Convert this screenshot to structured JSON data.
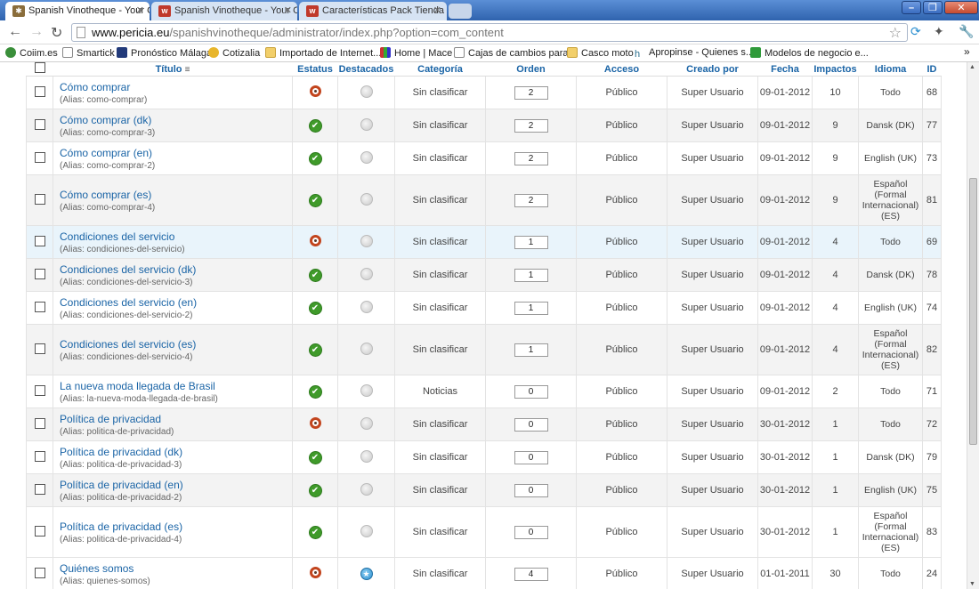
{
  "browser": {
    "tabs": [
      {
        "title": "Spanish Vinotheque - Your Or",
        "active": true
      },
      {
        "title": "Spanish Vinotheque - Your Or",
        "active": false
      },
      {
        "title": "Características Pack Tienda -",
        "active": false
      }
    ],
    "url_host": "www.pericia.eu",
    "url_path": "/spanishvinotheque/administrator/index.php?option=com_content",
    "bookmarks": [
      "Coiim.es",
      "Smartick",
      "Pronóstico Málaga",
      "Cotizalia",
      "Importado de Internet...",
      "Home | Mace",
      "Cajas de cambios para...",
      "Casco moto",
      "Apropinse - Quienes s...",
      "Modelos de negocio e..."
    ],
    "more_chevron": "»"
  },
  "table": {
    "headers": {
      "title": "Título",
      "status": "Estatus",
      "featured": "Destacados",
      "category": "Categoría",
      "order": "Orden",
      "access": "Acceso",
      "created_by": "Creado por",
      "date": "Fecha",
      "hits": "Impactos",
      "language": "Idioma",
      "id": "ID"
    },
    "rows": [
      {
        "title": "Cómo comprar",
        "alias": "(Alias: como-comprar)",
        "status": "unpublished",
        "featured": false,
        "category": "Sin clasificar",
        "order": "2",
        "access": "Público",
        "author": "Super Usuario",
        "date": "09-01-2012",
        "hits": "10",
        "language": "Todo",
        "id": "68"
      },
      {
        "title": "Cómo comprar (dk)",
        "alias": "(Alias: como-comprar-3)",
        "status": "published",
        "featured": false,
        "category": "Sin clasificar",
        "order": "2",
        "access": "Público",
        "author": "Super Usuario",
        "date": "09-01-2012",
        "hits": "9",
        "language": "Dansk (DK)",
        "id": "77"
      },
      {
        "title": "Cómo comprar (en)",
        "alias": "(Alias: como-comprar-2)",
        "status": "published",
        "featured": false,
        "category": "Sin clasificar",
        "order": "2",
        "access": "Público",
        "author": "Super Usuario",
        "date": "09-01-2012",
        "hits": "9",
        "language": "English (UK)",
        "id": "73"
      },
      {
        "title": "Cómo comprar (es)",
        "alias": "(Alias: como-comprar-4)",
        "status": "published",
        "featured": false,
        "category": "Sin clasificar",
        "order": "2",
        "access": "Público",
        "author": "Super Usuario",
        "date": "09-01-2012",
        "hits": "9",
        "language": "Español (Formal Internacional) (ES)",
        "id": "81"
      },
      {
        "title": "Condiciones del servicio",
        "alias": "(Alias: condiciones-del-servicio)",
        "status": "unpublished",
        "featured": false,
        "category": "Sin clasificar",
        "order": "1",
        "access": "Público",
        "author": "Super Usuario",
        "date": "09-01-2012",
        "hits": "4",
        "language": "Todo",
        "id": "69"
      },
      {
        "title": "Condiciones del servicio (dk)",
        "alias": "(Alias: condiciones-del-servicio-3)",
        "status": "published",
        "featured": false,
        "category": "Sin clasificar",
        "order": "1",
        "access": "Público",
        "author": "Super Usuario",
        "date": "09-01-2012",
        "hits": "4",
        "language": "Dansk (DK)",
        "id": "78"
      },
      {
        "title": "Condiciones del servicio (en)",
        "alias": "(Alias: condiciones-del-servicio-2)",
        "status": "published",
        "featured": false,
        "category": "Sin clasificar",
        "order": "1",
        "access": "Público",
        "author": "Super Usuario",
        "date": "09-01-2012",
        "hits": "4",
        "language": "English (UK)",
        "id": "74"
      },
      {
        "title": "Condiciones del servicio (es)",
        "alias": "(Alias: condiciones-del-servicio-4)",
        "status": "published",
        "featured": false,
        "category": "Sin clasificar",
        "order": "1",
        "access": "Público",
        "author": "Super Usuario",
        "date": "09-01-2012",
        "hits": "4",
        "language": "Español (Formal Internacional) (ES)",
        "id": "82"
      },
      {
        "title": "La nueva moda llegada de Brasil",
        "alias": "(Alias: la-nueva-moda-llegada-de-brasil)",
        "status": "published",
        "featured": false,
        "category": "Noticias",
        "order": "0",
        "access": "Público",
        "author": "Super Usuario",
        "date": "09-01-2012",
        "hits": "2",
        "language": "Todo",
        "id": "71"
      },
      {
        "title": "Política de privacidad",
        "alias": "(Alias: politica-de-privacidad)",
        "status": "unpublished",
        "featured": false,
        "category": "Sin clasificar",
        "order": "0",
        "access": "Público",
        "author": "Super Usuario",
        "date": "30-01-2012",
        "hits": "1",
        "language": "Todo",
        "id": "72"
      },
      {
        "title": "Política de privacidad (dk)",
        "alias": "(Alias: politica-de-privacidad-3)",
        "status": "published",
        "featured": false,
        "category": "Sin clasificar",
        "order": "0",
        "access": "Público",
        "author": "Super Usuario",
        "date": "30-01-2012",
        "hits": "1",
        "language": "Dansk (DK)",
        "id": "79"
      },
      {
        "title": "Política de privacidad (en)",
        "alias": "(Alias: politica-de-privacidad-2)",
        "status": "published",
        "featured": false,
        "category": "Sin clasificar",
        "order": "0",
        "access": "Público",
        "author": "Super Usuario",
        "date": "30-01-2012",
        "hits": "1",
        "language": "English (UK)",
        "id": "75"
      },
      {
        "title": "Política de privacidad (es)",
        "alias": "(Alias: politica-de-privacidad-4)",
        "status": "published",
        "featured": false,
        "category": "Sin clasificar",
        "order": "0",
        "access": "Público",
        "author": "Super Usuario",
        "date": "30-01-2012",
        "hits": "1",
        "language": "Español (Formal Internacional) (ES)",
        "id": "83"
      },
      {
        "title": "Quiénes somos",
        "alias": "(Alias: quienes-somos)",
        "status": "unpublished",
        "featured": true,
        "category": "Sin clasificar",
        "order": "4",
        "access": "Público",
        "author": "Super Usuario",
        "date": "01-01-2011",
        "hits": "30",
        "language": "Todo",
        "id": "24"
      }
    ]
  },
  "colors": {
    "link": "#1a64a6",
    "published": "#3f9a2a",
    "unpublished": "#c2441d",
    "tabbar": "#2f63ae"
  }
}
